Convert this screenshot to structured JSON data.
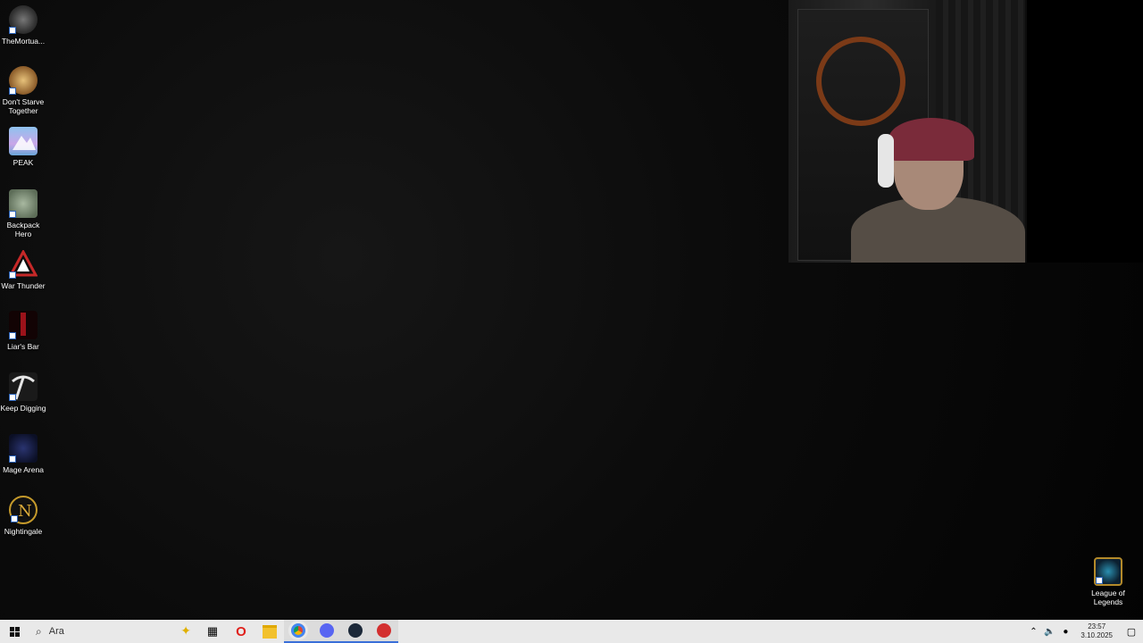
{
  "desktop": {
    "icons": [
      {
        "label": "TheMortua...",
        "icon": "skull-emblem-icon",
        "color": "#555555"
      },
      {
        "label": "Don't Starve Together",
        "icon": "dont-starve-icon",
        "color": "#b48a4a"
      },
      {
        "label": "PEAK",
        "icon": "mountain-icon",
        "color": "#6aa5d8"
      },
      {
        "label": "Backpack Hero",
        "icon": "mouse-hero-icon",
        "color": "#6f8a6a"
      },
      {
        "label": "War Thunder",
        "icon": "war-thunder-icon",
        "color": "#c62828"
      },
      {
        "label": "Liar's Bar",
        "icon": "liars-bar-icon",
        "color": "#8b0f14"
      },
      {
        "label": "Keep Digging",
        "icon": "pickaxe-icon",
        "color": "#d9d9d9"
      },
      {
        "label": "Mage Arena",
        "icon": "mage-arena-icon",
        "color": "#1a2250"
      },
      {
        "label": "Nightingale",
        "icon": "nightingale-icon",
        "color": "#c59a2b"
      }
    ],
    "right_icon": {
      "label": "League of Legends",
      "icon": "league-of-legends-icon",
      "color": "#b48a2a"
    }
  },
  "taskbar": {
    "search_placeholder": "Ara",
    "apps": [
      {
        "name": "task-view-icon",
        "glyph": "▦"
      },
      {
        "name": "opera-icon",
        "glyph": "O",
        "color": "#e0201b"
      },
      {
        "name": "file-explorer-icon",
        "glyph": "▬",
        "color": "#f2c12e"
      },
      {
        "name": "chrome-icon",
        "glyph": "●",
        "color": "#1e88e5"
      },
      {
        "name": "discord-icon",
        "glyph": "●",
        "color": "#5865f2"
      },
      {
        "name": "steam-icon",
        "glyph": "●",
        "color": "#1b2838"
      },
      {
        "name": "red-app-icon",
        "glyph": "●",
        "color": "#d32f2f"
      }
    ],
    "clock": {
      "time": "23:57",
      "date": "3.10.2025"
    }
  }
}
